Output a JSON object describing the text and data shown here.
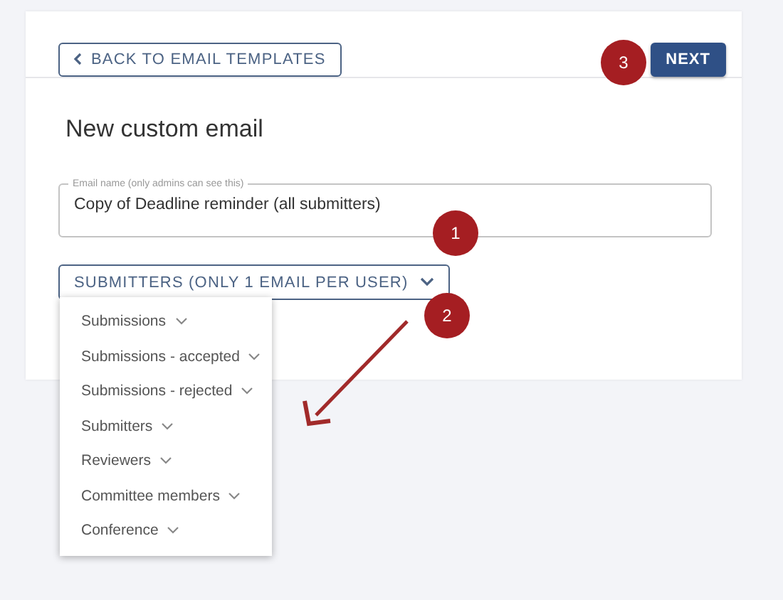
{
  "back_button": {
    "label": "BACK TO EMAIL TEMPLATES"
  },
  "next_button": {
    "label": "NEXT"
  },
  "title": "New custom email",
  "email_name_field": {
    "label": "Email name (only admins can see this)",
    "value": "Copy of Deadline reminder (all submitters)"
  },
  "recipient_dropdown": {
    "label": "SUBMITTERS (ONLY 1 EMAIL PER USER)",
    "expanded": true,
    "items": [
      {
        "label": "Submissions"
      },
      {
        "label": "Submissions - accepted"
      },
      {
        "label": "Submissions - rejected"
      },
      {
        "label": "Submitters"
      },
      {
        "label": "Reviewers"
      },
      {
        "label": "Committee members"
      },
      {
        "label": "Conference"
      }
    ]
  },
  "annotations": [
    {
      "label": "1"
    },
    {
      "label": "2"
    },
    {
      "label": "3"
    }
  ]
}
